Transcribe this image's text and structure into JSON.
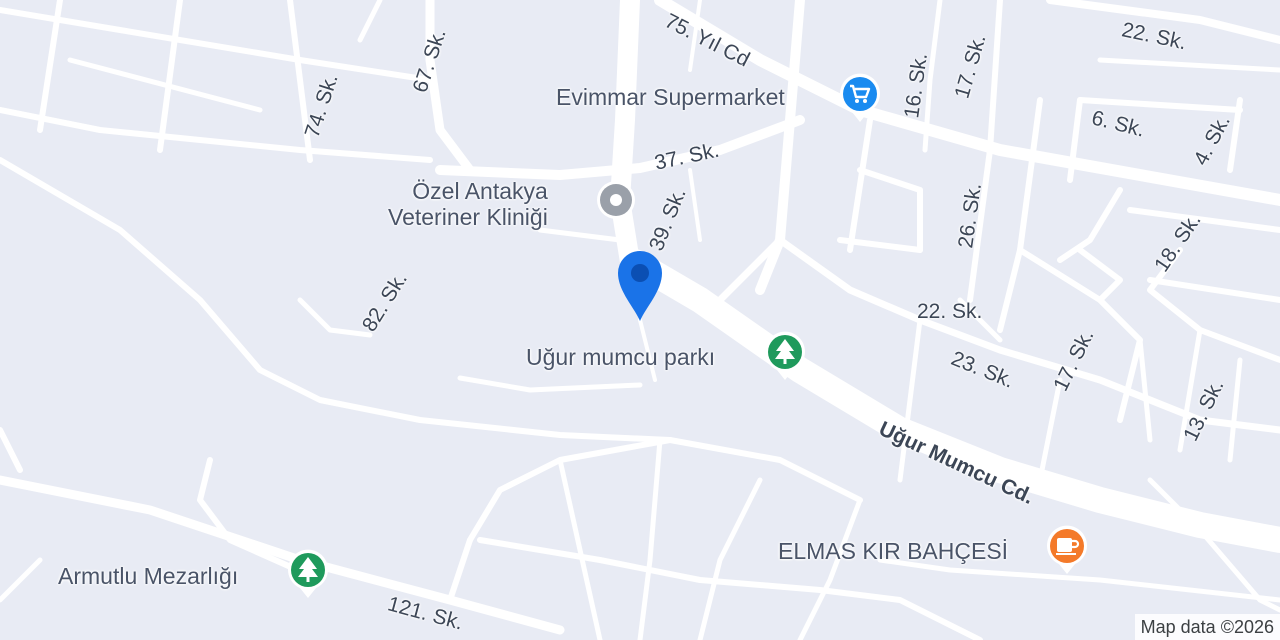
{
  "map": {
    "roads": [
      {
        "name": "75. Yıl Cd",
        "kind": "minor"
      },
      {
        "name": "22. Sk.",
        "kind": "minor"
      },
      {
        "name": "67. Sk.",
        "kind": "minor"
      },
      {
        "name": "74. Sk.",
        "kind": "minor"
      },
      {
        "name": "16. Sk.",
        "kind": "minor"
      },
      {
        "name": "17. Sk.",
        "kind": "minor"
      },
      {
        "name": "6. Sk.",
        "kind": "minor"
      },
      {
        "name": "4. Sk.",
        "kind": "minor"
      },
      {
        "name": "37. Sk.",
        "kind": "minor"
      },
      {
        "name": "39. Sk.",
        "kind": "minor"
      },
      {
        "name": "26. Sk.",
        "kind": "minor"
      },
      {
        "name": "18. Sk.",
        "kind": "minor"
      },
      {
        "name": "82. Sk.",
        "kind": "minor"
      },
      {
        "name": "22. Sk.",
        "kind": "minor"
      },
      {
        "name": "23. Sk.",
        "kind": "minor"
      },
      {
        "name": "17. Sk.",
        "kind": "minor"
      },
      {
        "name": "13. Sk.",
        "kind": "minor"
      },
      {
        "name": "Uğur Mumcu Cd.",
        "kind": "major"
      },
      {
        "name": "121. Sk.",
        "kind": "minor"
      }
    ],
    "pois": [
      {
        "name": "Evimmar Supermarket",
        "icon": "shopping-cart-icon",
        "color": "#1a8bf0"
      },
      {
        "name": "Özel Antakya\nVeteriner Kliniği",
        "icon": "generic-place-icon",
        "color": "#9aa0a9"
      },
      {
        "name": "Uğur mumcu parkı",
        "icon": "tree-icon",
        "color": "#1f9a5c"
      },
      {
        "name": "ELMAS KIR BAHÇESİ",
        "icon": "coffee-cup-icon",
        "color": "#f47a2a"
      },
      {
        "name": "Armutlu Mezarlığı",
        "icon": "tree-icon",
        "color": "#1f9a5c"
      }
    ],
    "location_marker": {
      "icon": "location-pin-icon",
      "color": "#1a73e8"
    },
    "attribution": "Map data ©2026"
  }
}
